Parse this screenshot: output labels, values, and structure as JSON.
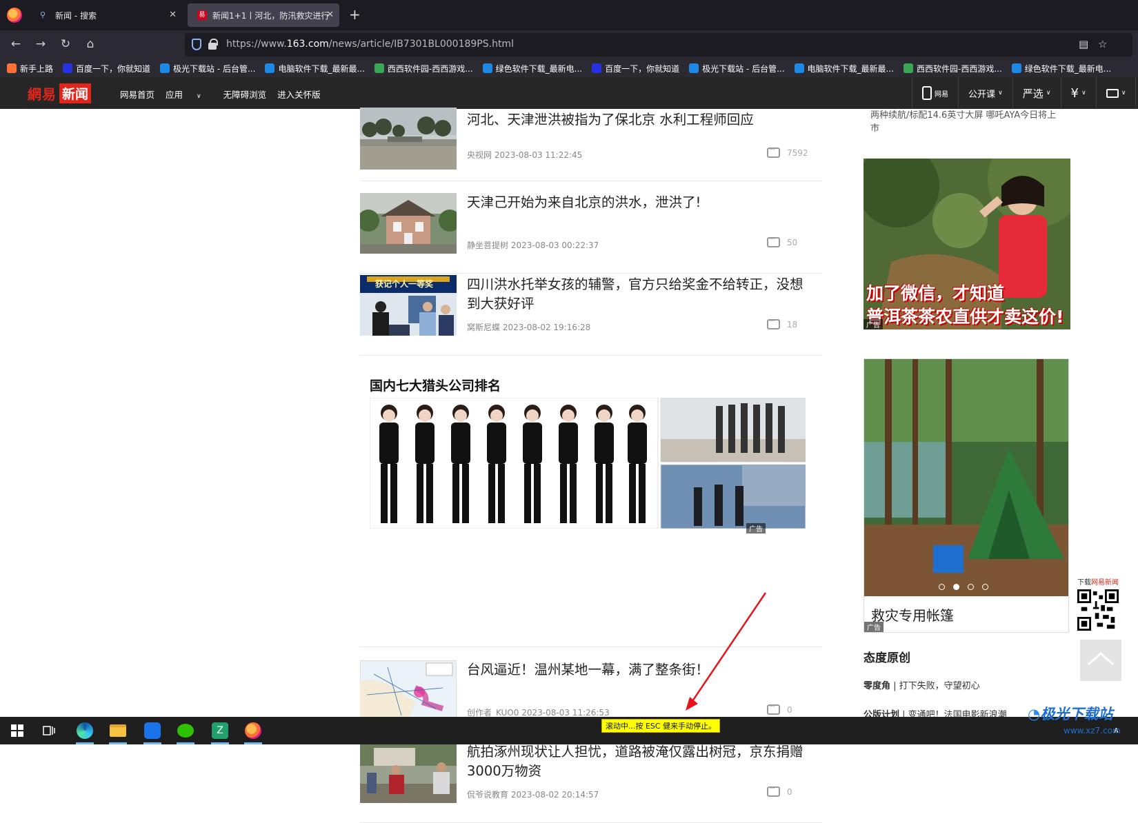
{
  "browser": {
    "tabs": [
      {
        "label": "新闻 - 搜索",
        "active": false
      },
      {
        "label": "新闻1+1丨河北，防汛救灾进行",
        "active": true
      }
    ],
    "url_prefix": "https://www.",
    "url_domain": "163.com",
    "url_path": "/news/article/IB7301BL000189PS.html",
    "bookmarks": [
      {
        "label": "新手上路",
        "icon": "firefox-icon",
        "color": "#ff7139"
      },
      {
        "label": "百度一下，你就知道",
        "icon": "baidu-icon",
        "color": "#2932e1"
      },
      {
        "label": "极光下载站 - 后台管...",
        "icon": "jiguang-icon",
        "color": "#1e88e5"
      },
      {
        "label": "电脑软件下载_最新最...",
        "icon": "ie-icon",
        "color": "#1e88e5"
      },
      {
        "label": "西西软件园-西西游戏...",
        "icon": "xixi-icon",
        "color": "#3aa757"
      },
      {
        "label": "绿色软件下载_最新电...",
        "icon": "green-soft-icon",
        "color": "#1e88e5"
      },
      {
        "label": "百度一下，你就知道",
        "icon": "baidu-icon",
        "color": "#2932e1"
      },
      {
        "label": "极光下载站 - 后台管...",
        "icon": "jiguang-icon",
        "color": "#1e88e5"
      },
      {
        "label": "电脑软件下载_最新最...",
        "icon": "ie-icon",
        "color": "#1e88e5"
      },
      {
        "label": "西西软件园-西西游戏...",
        "icon": "xixi-icon",
        "color": "#3aa757"
      },
      {
        "label": "绿色软件下载_最新电...",
        "icon": "green-soft-icon",
        "color": "#1e88e5"
      }
    ]
  },
  "site": {
    "logo_wy": "網易",
    "logo_news": "新闻",
    "nav": [
      "网易首页",
      "应用",
      "无障碍浏览",
      "进入关怀版"
    ],
    "right": [
      "网易",
      "公开课",
      "严选",
      "",
      ""
    ],
    "accent": "#e1251b"
  },
  "feed": [
    {
      "title": "河北、天津泄洪被指为了保北京 水利工程师回应",
      "source": "央视网",
      "time": "2023-08-03 11:22:45",
      "comments": "7592"
    },
    {
      "title": "天津己开始为来自北京的洪水，泄洪了!",
      "source": "静坐菩提树",
      "time": "2023-08-03 00:22:37",
      "comments": "50"
    },
    {
      "title": "四川洪水托举女孩的辅警，官方只给奖金不给转正，没想到大获好评",
      "source": "窝斯尼蝶",
      "time": "2023-08-02 19:16:28",
      "comments": "18"
    },
    {
      "title": "台风逼近！温州某地一幕，满了整条街！",
      "source": "创作者_KUO0",
      "time": "2023-08-03 11:26:53",
      "comments": "0"
    },
    {
      "title": "航拍涿州现状让人担忧，道路被淹仅露出树冠，京东捐赠3000万物资",
      "source": "侃爷说教育",
      "time": "2023-08-02 20:14:57",
      "comments": "0"
    }
  ],
  "thumb3_caption": "获记个人一等奖",
  "ad_block": {
    "title": "国内七大猎头公司排名",
    "tag": "广告"
  },
  "rail": {
    "top_text": "两种续航/标配14.6英寸大屏 哪吒AYA今日将上市",
    "ad1_caption_1": "加了微信，才知道",
    "ad1_caption_2": "普洱茶茶农直供才卖这价!",
    "ad_tag": "广告",
    "ad2_title": "救灾专用帐篷",
    "section_title": "态度原创",
    "links": [
      {
        "prefix": "零度角",
        "text": " | 打下失败，守望初心"
      },
      {
        "prefix": "公版计划",
        "text": " | 变通吧！法国电影新浪潮"
      }
    ],
    "qr_label_pre": "下载",
    "qr_label_red": "网易新闻"
  },
  "scroll_hint": "滚动中...按 ESC 健来手动停止。",
  "watermark": {
    "name": "极光下载站",
    "url": "www.xz7.com"
  }
}
